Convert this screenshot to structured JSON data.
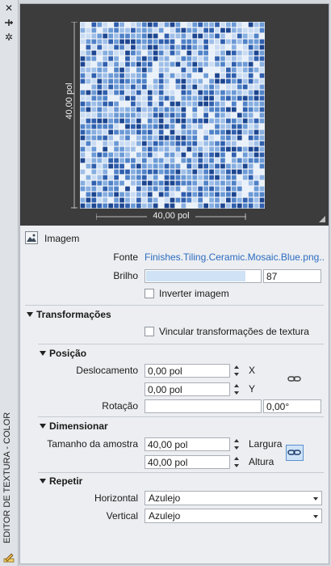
{
  "side": {
    "title": "EDITOR DE TEXTURA - COLOR",
    "close_icon": "close-icon",
    "pin_icon": "pin-icon",
    "settings_icon": "gear-icon"
  },
  "preview": {
    "width_label": "40,00 pol",
    "height_label": "40,00 pol",
    "colors": [
      "#2f5fae",
      "#6b9ad6",
      "#9fbfe8",
      "#c9dcf3",
      "#e8f0fa",
      "#1d4690",
      "#4f82c8",
      "#86aee0"
    ]
  },
  "image": {
    "header": "Imagem",
    "source_label": "Fonte",
    "source_value": "Finishes.Tiling.Ceramic.Mosaic.Blue.png...",
    "brightness_label": "Brilho",
    "brightness_value": "87",
    "brightness_fraction": 0.87,
    "invert_label": "Inverter imagem"
  },
  "transforms": {
    "header": "Transformações",
    "link_label": "Vincular transformações de textura",
    "position": {
      "header": "Posição",
      "offset_label": "Deslocamento",
      "offset_x": "0,00 pol",
      "offset_y": "0,00 pol",
      "x_label": "X",
      "y_label": "Y",
      "rotation_label": "Rotação",
      "rotation_value": "0,00°"
    },
    "scale": {
      "header": "Dimensionar",
      "sample_size_label": "Tamanho da amostra",
      "width_value": "40,00 pol",
      "height_value": "40,00 pol",
      "width_label": "Largura",
      "height_label": "Altura"
    },
    "repeat": {
      "header": "Repetir",
      "horizontal_label": "Horizontal",
      "horizontal_value": "Azulejo",
      "vertical_label": "Vertical",
      "vertical_value": "Azulejo"
    }
  }
}
